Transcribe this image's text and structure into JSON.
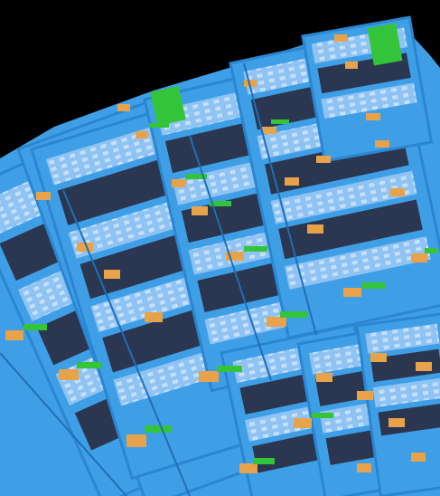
{
  "scene": {
    "description_visible_text": "",
    "palette": {
      "background": "#000000",
      "panel": "#3f9fe6",
      "panel_edge": "#2a86d0",
      "inner": "#8ec3f3",
      "dark_strip": "#2b3650",
      "pad": "#e8a24a",
      "green": "#34c43a"
    }
  }
}
